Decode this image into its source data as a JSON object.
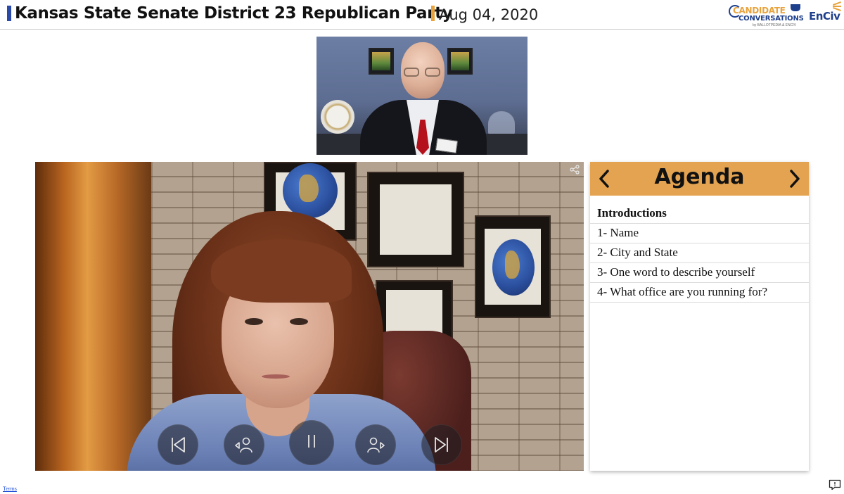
{
  "header": {
    "title": "Kansas State Senate District 23 Republican Party",
    "date": "Aug 04, 2020",
    "logo_candidate": "CANDIDATE",
    "logo_conversations": "CONVERSATIONS",
    "logo_by": "by BALLOTPEDIA & ENCIV",
    "logo_enciv": "EnCiv"
  },
  "icons": {
    "share": "share-icon",
    "prev_section": "skip-previous-icon",
    "prev_speaker": "previous-speaker-icon",
    "pause": "pause-icon",
    "next_speaker": "next-speaker-icon",
    "next_section": "skip-next-icon",
    "agenda_prev": "chevron-left-icon",
    "agenda_next": "chevron-right-icon",
    "feedback": "feedback-icon"
  },
  "agenda": {
    "title": "Agenda",
    "section": "Introductions",
    "items": [
      "1- Name",
      "2- City and State",
      "3- One word to describe yourself",
      "4- What office are you running for?"
    ]
  },
  "footer": {
    "terms": "Terms"
  },
  "colors": {
    "accent_gold": "#e3a350",
    "accent_blue": "#2b4aa8"
  }
}
